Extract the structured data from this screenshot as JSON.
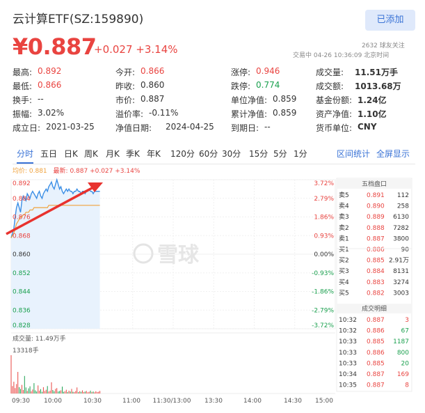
{
  "header": {
    "title": "云计算ETF(SZ:159890)",
    "follow_label": "已添加",
    "price": "¥0.887",
    "change": "+0.027 +3.14%",
    "fans": "2632 球友关注",
    "trade_time": "交易中 04-26 10:36:09 北京时间"
  },
  "stats": [
    [
      {
        "label": "最高:",
        "value": "0.892",
        "color": "red"
      },
      {
        "label": "今开:",
        "value": "0.866",
        "color": "red"
      },
      {
        "label": "涨停:",
        "value": "0.946",
        "color": "red"
      },
      {
        "label": "成交量:",
        "value": "11.51万手",
        "color": "bold"
      }
    ],
    [
      {
        "label": "最低:",
        "value": "0.866",
        "color": "red"
      },
      {
        "label": "昨收:",
        "value": "0.860",
        "color": "plain"
      },
      {
        "label": "跌停:",
        "value": "0.774",
        "color": "green"
      },
      {
        "label": "成交额:",
        "value": "1013.68万",
        "color": "bold"
      }
    ],
    [
      {
        "label": "换手:",
        "value": "--",
        "color": "plain"
      },
      {
        "label": "市价:",
        "value": "0.887",
        "color": "plain"
      },
      {
        "label": "单位净值:",
        "value": "0.859",
        "color": "plain"
      },
      {
        "label": "基金份额:",
        "value": "1.24亿",
        "color": "bold"
      }
    ],
    [
      {
        "label": "振幅:",
        "value": "3.02%",
        "color": "plain"
      },
      {
        "label": "溢价率:",
        "value": "-0.11%",
        "color": "plain"
      },
      {
        "label": "累计净值:",
        "value": "0.859",
        "color": "plain"
      },
      {
        "label": "资产净值:",
        "value": "1.10亿",
        "color": "bold"
      }
    ],
    [
      {
        "label": "成立日:",
        "value": "2021-03-25",
        "color": "plain"
      },
      {
        "label": "净值日期:",
        "value": "2024-04-25",
        "color": "plain"
      },
      {
        "label": "到期日:",
        "value": "--",
        "color": "plain"
      },
      {
        "label": "货币单位:",
        "value": "CNY",
        "color": "bold"
      }
    ]
  ],
  "tabs": [
    "分时",
    "五日",
    "日K",
    "周K",
    "月K",
    "季K",
    "年K",
    "120分",
    "60分",
    "30分",
    "15分",
    "5分",
    "1分"
  ],
  "tab_actions": [
    "区间统计",
    "全屏显示"
  ],
  "legend": {
    "avg": "均价: 0.881",
    "latest": "最新: 0.887 +0.027 +3.14%"
  },
  "watermark": "雪球",
  "volume": {
    "title": "成交量: 11.49万手",
    "max_label": "13318手"
  },
  "colors": {
    "up": "#e94440",
    "down": "#1aa04e",
    "accent": "#3a73d6",
    "avg_line": "#f0a23c",
    "price_line": "#3a8ee6"
  },
  "chart_data": {
    "type": "line",
    "prev_close": 0.86,
    "ylim": [
      0.828,
      0.892
    ],
    "left_ticks": [
      "0.892",
      "0.884",
      "0.876",
      "0.868",
      "0.860",
      "0.852",
      "0.844",
      "0.836",
      "0.828"
    ],
    "right_ticks": [
      "3.72%",
      "2.79%",
      "1.86%",
      "0.93%",
      "0.00%",
      "-0.93%",
      "-1.86%",
      "-2.79%",
      "-3.72%"
    ],
    "time_ticks": [
      "09:30",
      "10:00",
      "10:30",
      "11:00",
      "11:30/13:00",
      "13:30",
      "14:00",
      "14:30",
      "15:00"
    ],
    "price": [
      0.867,
      0.869,
      0.871,
      0.876,
      0.88,
      0.882,
      0.88,
      0.878,
      0.883,
      0.885,
      0.884,
      0.883,
      0.886,
      0.885,
      0.884,
      0.886,
      0.887,
      0.886,
      0.885,
      0.884,
      0.886,
      0.887,
      0.885,
      0.884,
      0.886,
      0.887,
      0.888,
      0.887,
      0.889,
      0.89,
      0.891,
      0.889,
      0.888,
      0.89,
      0.892,
      0.89,
      0.888,
      0.889,
      0.887,
      0.886,
      0.887,
      0.888,
      0.887,
      0.888,
      0.887,
      0.887,
      0.886,
      0.887,
      0.887,
      0.888,
      0.887,
      0.887,
      0.886,
      0.887,
      0.887,
      0.886,
      0.887,
      0.887,
      0.888,
      0.887,
      0.887,
      0.886,
      0.887,
      0.887,
      0.887,
      0.887,
      0.887
    ],
    "avg": [
      0.867,
      0.868,
      0.869,
      0.871,
      0.873,
      0.874,
      0.875,
      0.876,
      0.876,
      0.877,
      0.877,
      0.878,
      0.878,
      0.878,
      0.879,
      0.879,
      0.879,
      0.88,
      0.88,
      0.88,
      0.88,
      0.88,
      0.88,
      0.88,
      0.88,
      0.88,
      0.88,
      0.88,
      0.881,
      0.881,
      0.881,
      0.881,
      0.881,
      0.881,
      0.881,
      0.881,
      0.881,
      0.881,
      0.881,
      0.881,
      0.881,
      0.881,
      0.881,
      0.881,
      0.881,
      0.881,
      0.881,
      0.881,
      0.881,
      0.881,
      0.881,
      0.881,
      0.881,
      0.881,
      0.881,
      0.881,
      0.881,
      0.881,
      0.881,
      0.881,
      0.881,
      0.881,
      0.881,
      0.881,
      0.881,
      0.881,
      0.881
    ],
    "volume": [
      13318,
      2600,
      4100,
      1900,
      3300,
      7500,
      2200,
      1600,
      3000,
      1200,
      6100,
      2100,
      900,
      1800,
      2500,
      800,
      1400,
      3600,
      1100,
      700,
      2800,
      1000,
      1500,
      600,
      2200,
      900,
      1300,
      2600,
      700,
      1000,
      3900,
      1200,
      800,
      1600,
      1900,
      700,
      900,
      1100,
      2400,
      600,
      800,
      1300,
      500,
      1000,
      700,
      1600,
      600,
      500,
      900,
      2100,
      500,
      800,
      600,
      1100,
      500,
      700,
      900,
      400,
      600,
      1000,
      500,
      700,
      400,
      800,
      500,
      600,
      900
    ]
  },
  "orderbook": {
    "title": "五档盘口",
    "asks": [
      {
        "label": "卖5",
        "price": "0.891",
        "vol": "112"
      },
      {
        "label": "卖4",
        "price": "0.890",
        "vol": "258"
      },
      {
        "label": "卖3",
        "price": "0.889",
        "vol": "6130"
      },
      {
        "label": "卖2",
        "price": "0.888",
        "vol": "7282"
      },
      {
        "label": "卖1",
        "price": "0.887",
        "vol": "3800"
      }
    ],
    "bids": [
      {
        "label": "买1",
        "price": "0.886",
        "vol": "90"
      },
      {
        "label": "买2",
        "price": "0.885",
        "vol": "2.91万"
      },
      {
        "label": "买3",
        "price": "0.884",
        "vol": "8131"
      },
      {
        "label": "买4",
        "price": "0.883",
        "vol": "3274"
      },
      {
        "label": "买5",
        "price": "0.882",
        "vol": "3003"
      }
    ]
  },
  "trades": {
    "title": "成交明细",
    "rows": [
      {
        "time": "10:32",
        "price": "0.887",
        "vol": "3"
      },
      {
        "time": "10:32",
        "price": "0.886",
        "vol": "67"
      },
      {
        "time": "10:33",
        "price": "0.885",
        "vol": "1187"
      },
      {
        "time": "10:33",
        "price": "0.886",
        "vol": "800"
      },
      {
        "time": "10:33",
        "price": "0.885",
        "vol": "20"
      },
      {
        "time": "10:34",
        "price": "0.887",
        "vol": "169"
      },
      {
        "time": "10:35",
        "price": "0.887",
        "vol": "8"
      }
    ]
  }
}
